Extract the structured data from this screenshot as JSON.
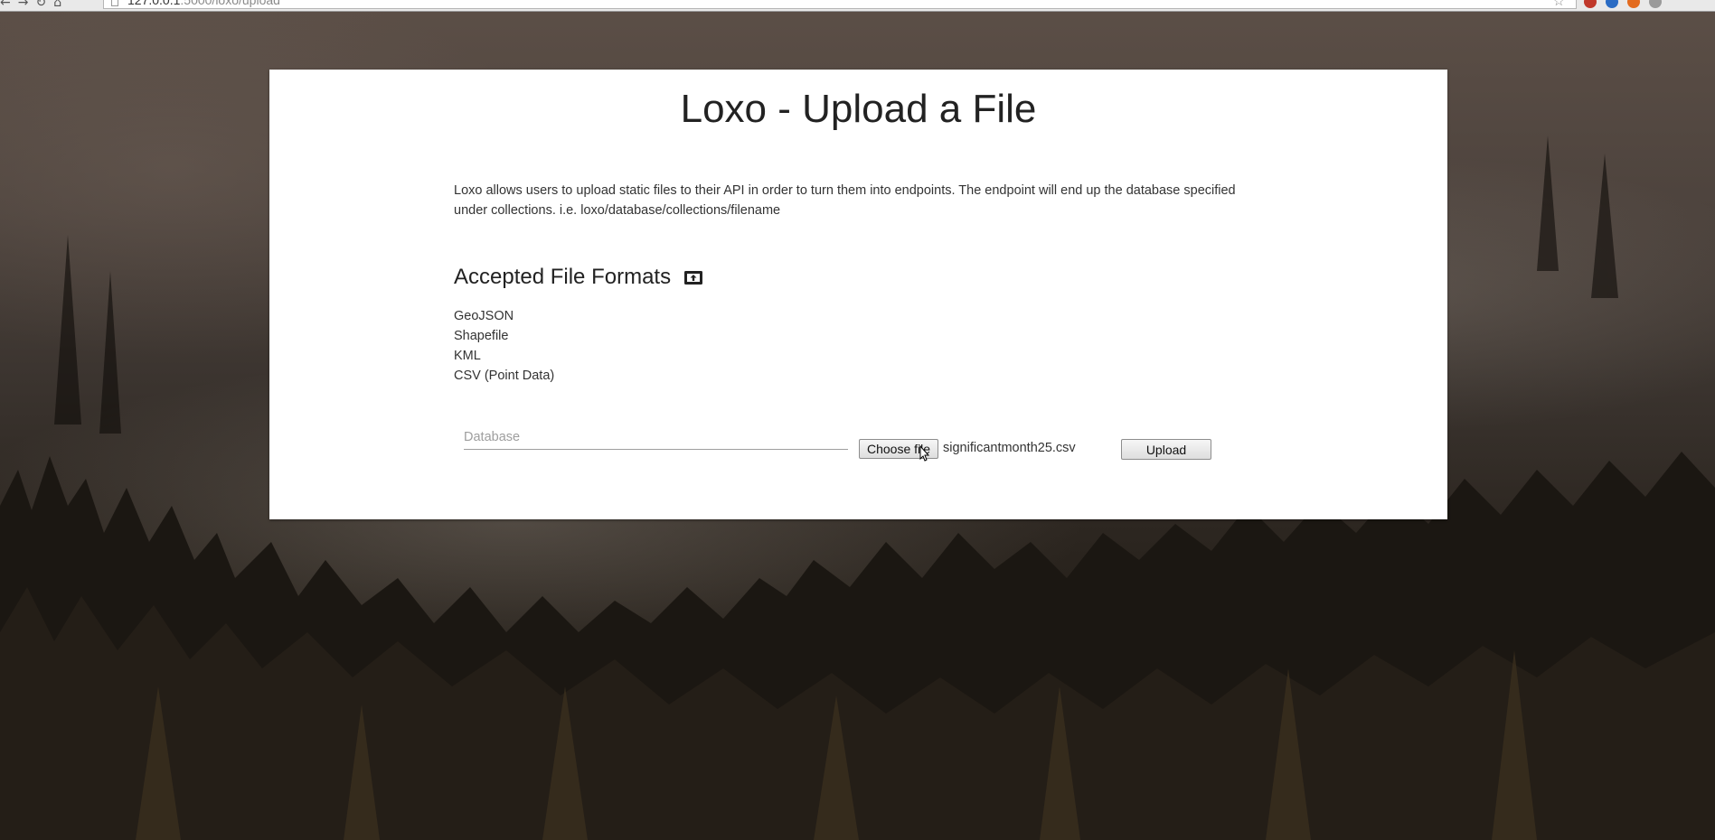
{
  "browser": {
    "url_host": "127.0.0.1",
    "url_rest": ":5000/loxo/upload"
  },
  "page": {
    "title": "Loxo - Upload a File",
    "intro": "Loxo allows users to upload static files to their API in order to turn them into endpoints. The endpoint will end up the database specified under collections. i.e. loxo/database/collections/filename",
    "formats_heading": "Accepted File Formats",
    "formats": [
      "GeoJSON",
      "Shapefile",
      "KML",
      "CSV (Point Data)"
    ]
  },
  "form": {
    "database_placeholder": "Database",
    "database_value": "",
    "choose_file_label": "Choose file",
    "selected_file": "significantmonth25.csv",
    "upload_label": "Upload"
  },
  "icons": {
    "heading_icon": "upload-box-icon",
    "ext_colors": [
      "#c0392b",
      "#2b6cc4",
      "#e36b1f",
      "#9a9a9a"
    ]
  }
}
